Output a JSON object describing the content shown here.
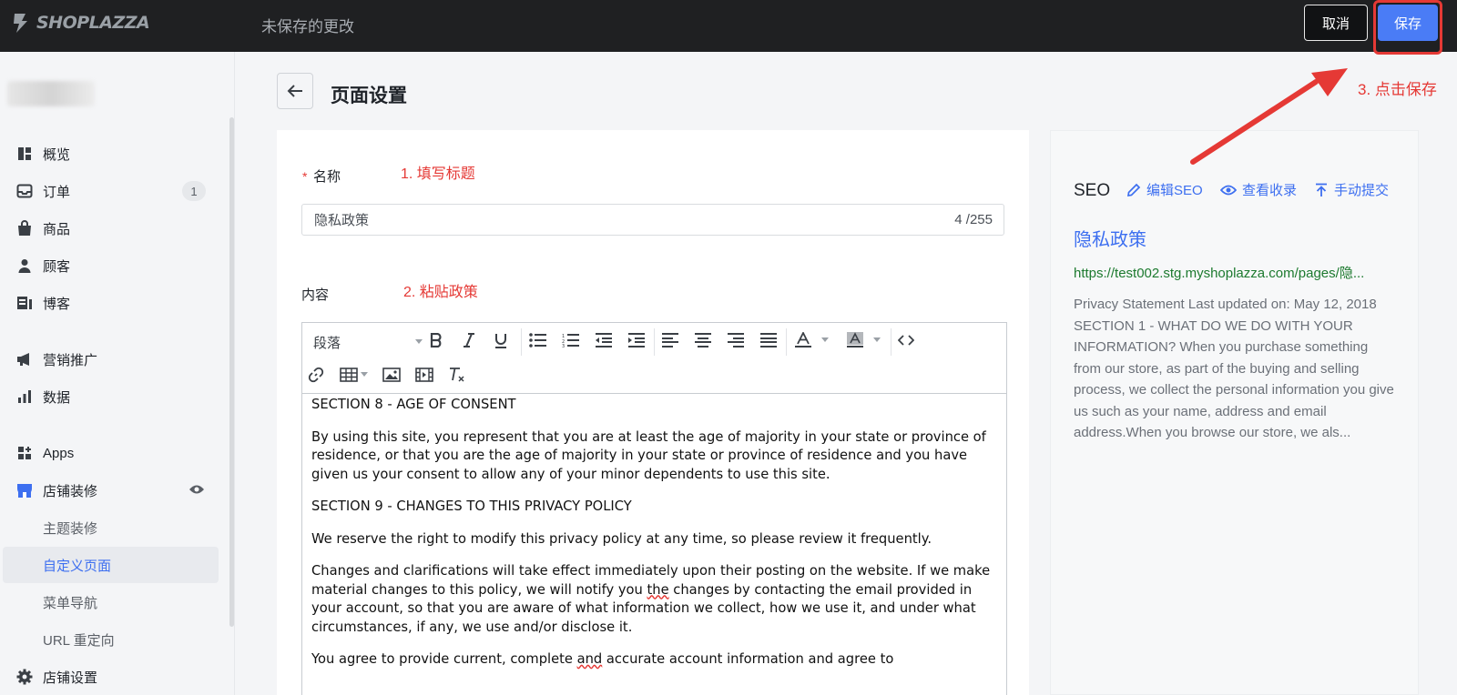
{
  "topbar": {
    "brand": "SHOPLAZZA",
    "unsaved_text": "未保存的更改",
    "cancel_label": "取消",
    "save_label": "保存"
  },
  "sidebar": {
    "items": [
      {
        "label": "概览",
        "icon": "dashboard-icon"
      },
      {
        "label": "订单",
        "icon": "inbox-icon",
        "badge": "1"
      },
      {
        "label": "商品",
        "icon": "bag-icon"
      },
      {
        "label": "顾客",
        "icon": "person-icon"
      },
      {
        "label": "博客",
        "icon": "blog-icon"
      },
      {
        "label": "营销推广",
        "icon": "megaphone-icon"
      },
      {
        "label": "数据",
        "icon": "bar-chart-icon"
      },
      {
        "label": "Apps",
        "icon": "apps-icon"
      },
      {
        "label": "店铺装修",
        "icon": "store-icon"
      },
      {
        "label": "主题装修"
      },
      {
        "label": "自定义页面"
      },
      {
        "label": "菜单导航"
      },
      {
        "label": "URL 重定向"
      },
      {
        "label": "店铺设置",
        "icon": "gear-icon"
      }
    ]
  },
  "page": {
    "title": "页面设置",
    "name_label": "名称",
    "name_required": "*",
    "name_value": "隐私政策",
    "name_counter": "4 /255",
    "content_label": "内容",
    "format_select": "段落"
  },
  "annotations": {
    "step1": "1. 填写标题",
    "step2": "2. 粘贴政策",
    "step3": "3. 点击保存",
    "color": "#e53935"
  },
  "editor": {
    "h8": "SECTION 8 - AGE OF CONSENT",
    "p8": "By using this site, you represent that you are at least the age of majority in your state or province of residence, or that you are the age of majority in your state or province of residence and you have given us your consent to allow any of your minor dependents to use this site.",
    "h9": "SECTION 9 - CHANGES TO THIS PRIVACY POLICY",
    "p9a": "We reserve the right to modify this privacy policy at any time, so please review it frequently.",
    "p9b_1": "Changes and clarifications will take effect immediately upon their posting on the website. If we make material changes to this policy, we will notify you ",
    "p9b_flag": "the",
    "p9b_2": " changes by contacting the email provided in your account, so that you are aware of what information we collect, how we use it, and under what circumstances, if any, we use and/or disclose it.",
    "p9c_1": "You agree to provide current, complete ",
    "p9c_flag": "and",
    "p9c_2": " accurate account information and agree to"
  },
  "seo": {
    "title": "SEO",
    "edit_label": "编辑SEO",
    "view_label": "查看收录",
    "submit_label": "手动提交",
    "page_title": "隐私政策",
    "url": "https://test002.stg.myshoplazza.com/pages/隐...",
    "description": "Privacy Statement Last updated on: May 12, 2018 SECTION 1 - WHAT DO WE DO WITH YOUR INFORMATION? When you purchase something from our store, as part of the buying and selling process, we collect the personal information you give us such as your name, address and email address.When you browse our store, we als..."
  },
  "colors": {
    "accent": "#3d6ff0",
    "save_button": "#4a7cf6",
    "topbar": "#1f2022",
    "url_green": "#1d7a2f"
  }
}
